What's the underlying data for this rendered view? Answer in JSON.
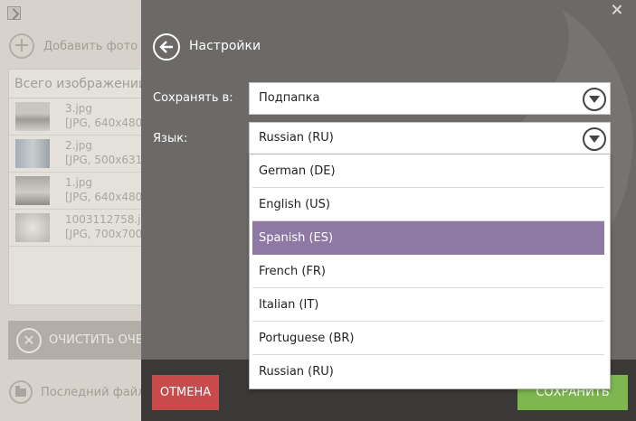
{
  "background_app": {
    "app_icon": "app-logo-icon",
    "add_photo_label": "Добавить фото",
    "list_header": "Всего изображений",
    "files": [
      {
        "name": "3.jpg",
        "meta": "[JPG, 640x480,"
      },
      {
        "name": "2.jpg",
        "meta": "[JPG, 500x631,"
      },
      {
        "name": "1.jpg",
        "meta": "[JPG, 640x480,"
      },
      {
        "name": "1003112758.jp",
        "meta": "[JPG, 700x700,"
      }
    ],
    "clear_label": "ОЧИСТИТЬ ОЧЕ",
    "last_file_label": "Последний файл:"
  },
  "settings": {
    "title": "Настройки",
    "save_to_label": "Сохранять в:",
    "save_to_value": "Подпапка",
    "language_label": "Язык:",
    "language_value": "Russian (RU)",
    "language_options": [
      {
        "label": "German (DE)"
      },
      {
        "label": "English (US)"
      },
      {
        "label": "Spanish (ES)"
      },
      {
        "label": "French (FR)"
      },
      {
        "label": "Italian (IT)"
      },
      {
        "label": "Portuguese (BR)"
      },
      {
        "label": "Russian (RU)"
      }
    ],
    "highlighted_option": "Spanish (ES)",
    "cancel_label": "ОТМЕНА",
    "save_label": "СОХРАНИТЬ"
  },
  "colors": {
    "overlay_bg": "#6b6a68",
    "highlight": "#8e78a4",
    "cancel": "#c94a4a",
    "save": "#7eb64f"
  }
}
